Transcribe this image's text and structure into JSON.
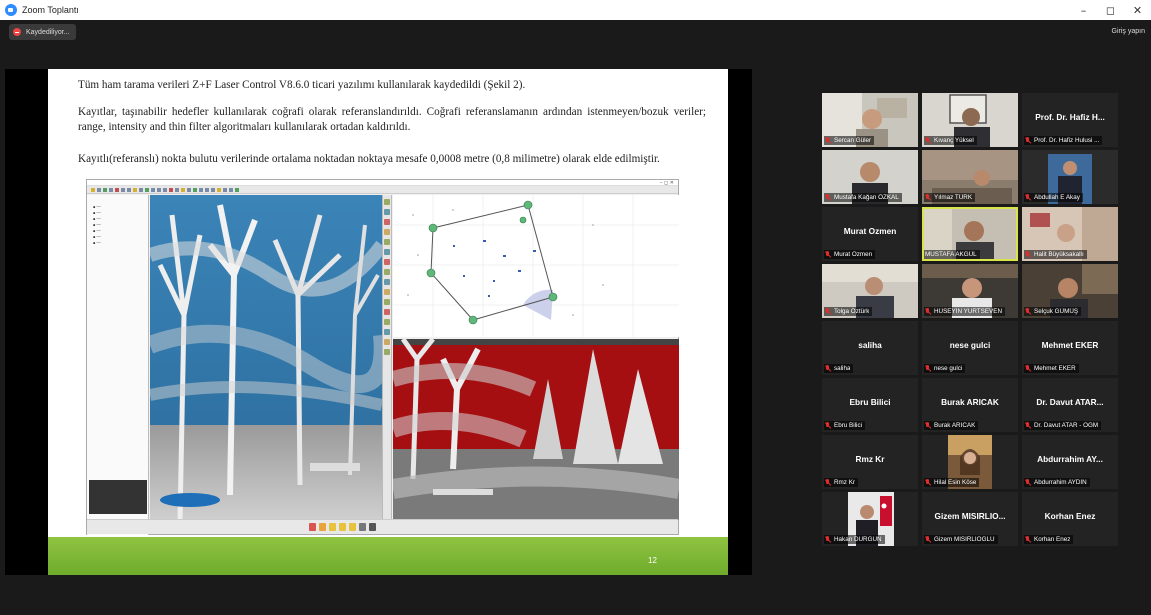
{
  "window": {
    "title": "Zoom Toplantı",
    "controls": [
      "–",
      "◻",
      "✕"
    ]
  },
  "recording": {
    "label": "Kaydediliyor..."
  },
  "header": {
    "signin_label": "Giriş yapın"
  },
  "slide": {
    "paragraph1": "Tüm ham tarama verileri Z+F Laser Control V8.6.0 ticari yazılımı kullanılarak kaydedildi (Şekil 2).",
    "paragraph2": "Kayıtlar, taşınabilir hedefler kullanılarak coğrafi olarak referanslandırıldı. Coğrafi referanslamanın ardından istenmeyen/bozuk veriler; range, intensity and thin filter algoritmaları kullanılarak ortadan kaldırıldı.",
    "paragraph3": "Kayıtlı(referanslı) nokta bulutu verilerinde ortalama noktadan noktaya mesafe 0,0008 metre (0,8 milimetre) olarak elde edilmiştir.",
    "page_number": "12"
  },
  "participants": [
    {
      "name": "Sercan Güler",
      "display": "video",
      "muted": true
    },
    {
      "name": "Kıvanç Yüksel",
      "display": "video",
      "muted": true
    },
    {
      "name": "Prof. Dr. Hafiz Hulusi ...",
      "big_label": "Prof. Dr. Hafiz H...",
      "display": "name",
      "muted": true
    },
    {
      "name": "Mustafa Kağan ÖZKAL",
      "display": "video",
      "muted": true
    },
    {
      "name": "Yılmaz TÜRK",
      "display": "video",
      "muted": true
    },
    {
      "name": "Abdullah E Akay",
      "display": "video",
      "muted": true
    },
    {
      "name": "Murat Ozmen",
      "big_label": "Murat Ozmen",
      "display": "name",
      "muted": true
    },
    {
      "name": "MUSTAFA AKGÜL",
      "display": "video",
      "muted": false,
      "active_speaker": true
    },
    {
      "name": "Halit Büyüksakallı",
      "display": "video",
      "muted": true
    },
    {
      "name": "Tolga Öztürk",
      "display": "video",
      "muted": true
    },
    {
      "name": "HÜSEYİN YURTSEVEN",
      "display": "video",
      "muted": true
    },
    {
      "name": "Selçuk GÜMÜŞ",
      "display": "video",
      "muted": true
    },
    {
      "name": "saliha",
      "big_label": "saliha",
      "display": "name",
      "muted": true
    },
    {
      "name": "nese gulci",
      "big_label": "nese gulci",
      "display": "name",
      "muted": true
    },
    {
      "name": "Mehmet EKER",
      "big_label": "Mehmet EKER",
      "display": "name",
      "muted": true
    },
    {
      "name": "Ebru Bilici",
      "big_label": "Ebru Bilici",
      "display": "name",
      "muted": true
    },
    {
      "name": "Burak ARICAK",
      "big_label": "Burak ARICAK",
      "display": "name",
      "muted": true
    },
    {
      "name": "Dr. Davut ATAR - OGM",
      "big_label": "Dr. Davut ATAR...",
      "display": "name",
      "muted": true
    },
    {
      "name": "Rmz Kr",
      "big_label": "Rmz Kr",
      "display": "name",
      "muted": true
    },
    {
      "name": "Hilal Esin Köse",
      "display": "photo",
      "muted": true
    },
    {
      "name": "Abdurrahim AYDIN",
      "big_label": "Abdurrahim AY...",
      "display": "name",
      "muted": true
    },
    {
      "name": "Hakan DURGUN",
      "display": "photo",
      "muted": true
    },
    {
      "name": "Gizem MISIRLIOGLU",
      "big_label": "Gizem MISIRLIO...",
      "display": "name",
      "muted": true
    },
    {
      "name": "Korhan Enez",
      "big_label": "Korhan Enez",
      "display": "name",
      "muted": true
    }
  ],
  "colors": {
    "background": "#1a1a1a",
    "tile": "#232323",
    "active_speaker_border": "#d8e44a",
    "muted_icon": "#e02d2d",
    "slide_footer": "#7cb734"
  }
}
